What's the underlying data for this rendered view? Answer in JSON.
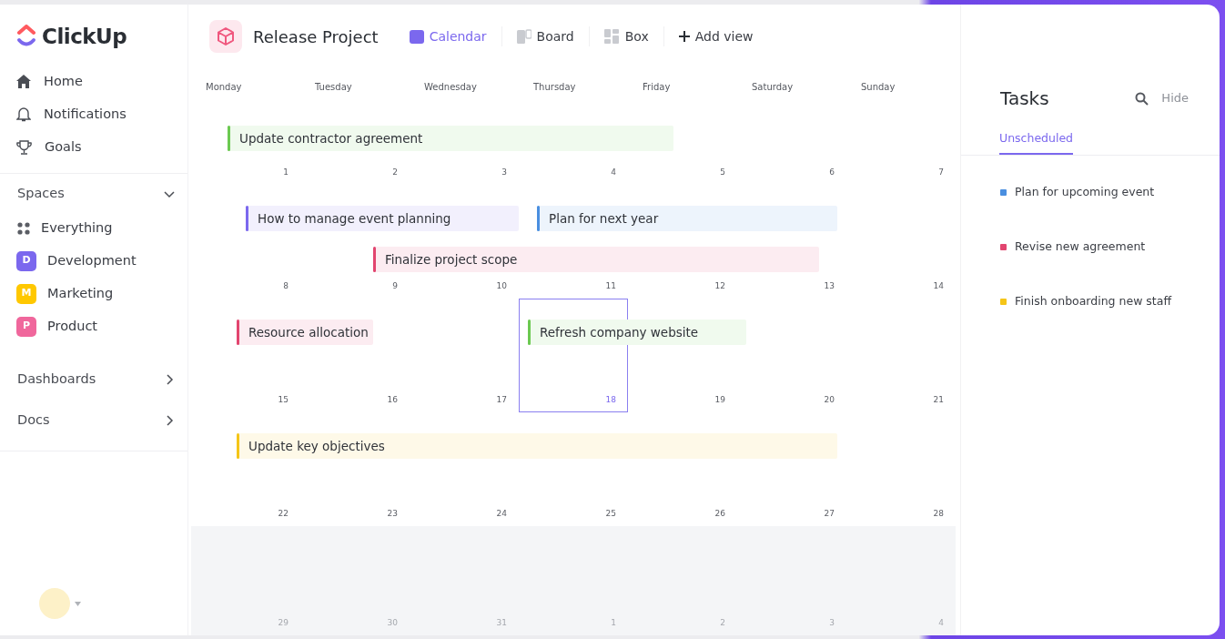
{
  "brand": {
    "name": "ClickUp"
  },
  "nav": [
    {
      "kind": "home",
      "label": "Home"
    },
    {
      "kind": "bell",
      "label": "Notifications"
    },
    {
      "kind": "trophy",
      "label": "Goals"
    }
  ],
  "spaces": {
    "title": "Spaces",
    "expanded": true,
    "items": [
      {
        "kind": "all",
        "label": "Everything"
      },
      {
        "kind": "space",
        "initial": "D",
        "label": "Development",
        "color": "#7b68ee"
      },
      {
        "kind": "space",
        "initial": "M",
        "label": "Marketing",
        "color": "#ffc800"
      },
      {
        "kind": "space",
        "initial": "P",
        "label": "Product",
        "color": "#f0679c"
      }
    ]
  },
  "sections": [
    {
      "label": "Dashboards",
      "expanded": false
    },
    {
      "label": "Docs",
      "expanded": false
    }
  ],
  "project": {
    "title": "Release Project"
  },
  "views": [
    {
      "kind": "calendar",
      "label": "Calendar",
      "selected": true
    },
    {
      "kind": "board",
      "label": "Board",
      "selected": false
    },
    {
      "kind": "box",
      "label": "Box",
      "selected": false
    },
    {
      "kind": "add",
      "label": "Add view",
      "selected": false
    }
  ],
  "calendar": {
    "weekdays": [
      "Monday",
      "Tuesday",
      "Wednesday",
      "Thursday",
      "Friday",
      "Saturday",
      "Sunday"
    ],
    "weeks": [
      {
        "days": [
          {
            "label": "1",
            "today": false
          },
          {
            "label": "2",
            "today": false
          },
          {
            "label": "3",
            "today": false
          },
          {
            "label": "4",
            "today": false
          },
          {
            "label": "5",
            "today": false
          },
          {
            "label": "6",
            "today": false
          },
          {
            "label": "7",
            "today": false
          }
        ],
        "events": [
          {
            "title": "Update contractor agreement",
            "color": "#6bc950"
          }
        ]
      },
      {
        "days": [
          {
            "label": "8",
            "today": false
          },
          {
            "label": "9",
            "today": false
          },
          {
            "label": "10",
            "today": false
          },
          {
            "label": "11",
            "today": false
          },
          {
            "label": "12",
            "today": false
          },
          {
            "label": "13",
            "today": false
          },
          {
            "label": "14",
            "today": false
          }
        ],
        "events": [
          {
            "title": "How to manage event planning",
            "color": "#7b68ee"
          },
          {
            "title": "Plan for next year",
            "color": "#4a8fe0"
          },
          {
            "title": "Finalize project scope",
            "color": "#e2456f"
          }
        ]
      },
      {
        "days": [
          {
            "label": "15",
            "today": false
          },
          {
            "label": "16",
            "today": false
          },
          {
            "label": "17",
            "today": false
          },
          {
            "label": "18",
            "today": true
          },
          {
            "label": "19",
            "today": false
          },
          {
            "label": "20",
            "today": false
          },
          {
            "label": "21",
            "today": false
          }
        ],
        "events": [
          {
            "title": "Resource allocation",
            "color": "#e2456f"
          },
          {
            "title": "Refresh company website",
            "color": "#6bc950"
          }
        ]
      },
      {
        "days": [
          {
            "label": "22",
            "today": false
          },
          {
            "label": "23",
            "today": false
          },
          {
            "label": "24",
            "today": false
          },
          {
            "label": "25",
            "today": false
          },
          {
            "label": "26",
            "today": false
          },
          {
            "label": "27",
            "today": false
          },
          {
            "label": "28",
            "today": false
          }
        ],
        "events": [
          {
            "title": "Update key objectives",
            "color": "#f5c518"
          }
        ]
      },
      {
        "faded": true,
        "days": [
          {
            "label": "29",
            "today": false
          },
          {
            "label": "30",
            "today": false
          },
          {
            "label": "31",
            "today": false
          },
          {
            "label": "1",
            "today": false
          },
          {
            "label": "2",
            "today": false
          },
          {
            "label": "3",
            "today": false
          },
          {
            "label": "4",
            "today": false
          }
        ]
      }
    ]
  },
  "tasks_panel": {
    "title": "Tasks",
    "hide_label": "Hide",
    "tabs": [
      {
        "label": "Unscheduled",
        "selected": true
      }
    ],
    "items": [
      {
        "label": "Plan for upcoming event",
        "color": "#4a8fe0"
      },
      {
        "label": "Revise new agreement",
        "color": "#e2456f"
      },
      {
        "label": "Finish onboarding new staff",
        "color": "#f5c518"
      }
    ]
  }
}
